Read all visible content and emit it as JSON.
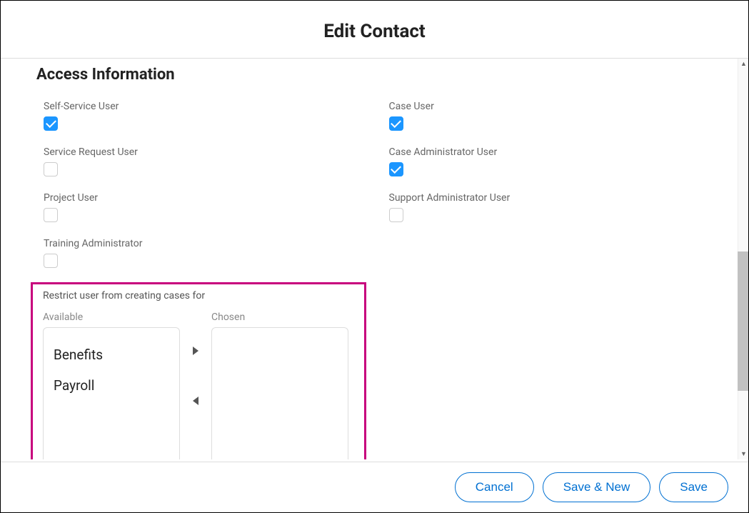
{
  "header": {
    "title": "Edit Contact"
  },
  "section": {
    "title": "Access Information"
  },
  "fields": {
    "left": [
      {
        "label": "Self-Service User",
        "checked": true
      },
      {
        "label": "Service Request User",
        "checked": false
      },
      {
        "label": "Project User",
        "checked": false
      },
      {
        "label": "Training Administrator",
        "checked": false
      }
    ],
    "right": [
      {
        "label": "Case User",
        "checked": true
      },
      {
        "label": "Case Administrator User",
        "checked": true
      },
      {
        "label": "Support Administrator User",
        "checked": false
      }
    ]
  },
  "restrict": {
    "label": "Restrict user from creating cases for",
    "available_label": "Available",
    "chosen_label": "Chosen",
    "available": [
      "Benefits",
      "Payroll"
    ],
    "chosen": []
  },
  "footer": {
    "cancel": "Cancel",
    "save_new": "Save & New",
    "save": "Save"
  }
}
